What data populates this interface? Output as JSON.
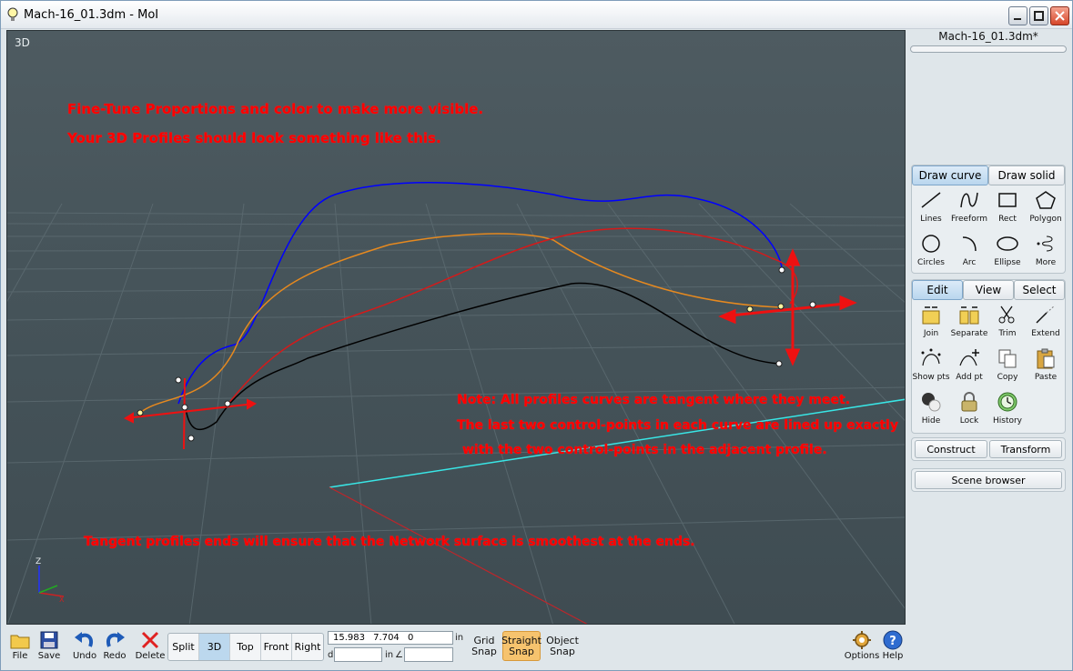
{
  "window": {
    "title": "Mach-16_01.3dm - MoI"
  },
  "viewport": {
    "label": "3D",
    "notes": {
      "top_line1": "Fine-Tune Proportions and color to make more visible.",
      "top_line2": "Your 3D Profiles should look something like this.",
      "mid_line1": "Note: All profiles curves are tangent where they meet.",
      "mid_line2": "The last two control-points in each curve are lined up exactly",
      "mid_line3": "with the two control-points in the adjacent profile.",
      "bottom": "Tangent profiles ends will ensure that the Network surface is smoothest at the ends."
    },
    "axis": {
      "z": "Z",
      "x": "X"
    }
  },
  "side_panel": {
    "filename": "Mach-16_01.3dm*",
    "draw_tabs": [
      "Draw curve",
      "Draw solid"
    ],
    "draw_tools": [
      "Lines",
      "Freeform",
      "Rect",
      "Polygon",
      "Circles",
      "Arc",
      "Ellipse",
      "More"
    ],
    "edit_tabs": [
      "Edit",
      "View",
      "Select"
    ],
    "edit_tools": [
      "Join",
      "Separate",
      "Trim",
      "Extend",
      "Show pts",
      "Add pt",
      "Copy",
      "Paste",
      "Hide",
      "Lock",
      "History"
    ],
    "construct": "Construct",
    "transform": "Transform",
    "scene_browser": "Scene browser"
  },
  "bottom_bar": {
    "file": "File",
    "save": "Save",
    "undo": "Undo",
    "redo": "Redo",
    "delete": "Delete",
    "views": [
      "Split",
      "3D",
      "Top",
      "Front",
      "Right"
    ],
    "active_view": "3D",
    "coords": "15.983 7.704 0",
    "unit": "in",
    "d_label": "d",
    "d_unit": "in",
    "angle_label": "∠",
    "grid_snap": [
      "Grid",
      "Snap"
    ],
    "straight_snap": [
      "Straight",
      "Snap"
    ],
    "object_snap": [
      "Object",
      "Snap"
    ],
    "options": "Options",
    "help": "Help"
  },
  "colors": {
    "note_red": "#ff0000",
    "viewport_bg": "#46545a",
    "curve_blue": "#0000ff",
    "curve_orange": "#e6891f",
    "curve_red": "#d41a1a",
    "curve_black": "#000000",
    "axis_cyan": "#39e6e6"
  }
}
